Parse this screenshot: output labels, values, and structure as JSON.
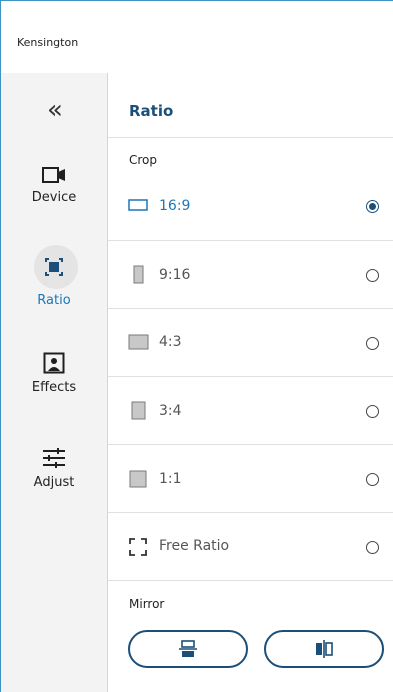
{
  "app": {
    "title": "Kensington"
  },
  "sidebar": {
    "collapse_glyph": "«",
    "items": [
      {
        "label": "Device",
        "icon": "camera-icon",
        "active": false
      },
      {
        "label": "Ratio",
        "icon": "ratio-icon",
        "active": true
      },
      {
        "label": "Effects",
        "icon": "portrait-icon",
        "active": false
      },
      {
        "label": "Adjust",
        "icon": "sliders-icon",
        "active": false
      }
    ]
  },
  "panel": {
    "title": "Ratio",
    "crop_label": "Crop",
    "options": [
      {
        "label": "16:9",
        "selected": true
      },
      {
        "label": "9:16",
        "selected": false
      },
      {
        "label": "4:3",
        "selected": false
      },
      {
        "label": "3:4",
        "selected": false
      },
      {
        "label": "1:1",
        "selected": false
      },
      {
        "label": "Free Ratio",
        "selected": false
      }
    ],
    "mirror_label": "Mirror",
    "mirror_buttons": [
      {
        "name": "flip-vertical",
        "icon": "flip-vertical-icon"
      },
      {
        "name": "flip-horizontal",
        "icon": "flip-horizontal-icon"
      }
    ]
  },
  "colors": {
    "accent": "#1b77b8",
    "dark_accent": "#1b4f7a",
    "sidebar_bg": "#f3f3f3"
  }
}
